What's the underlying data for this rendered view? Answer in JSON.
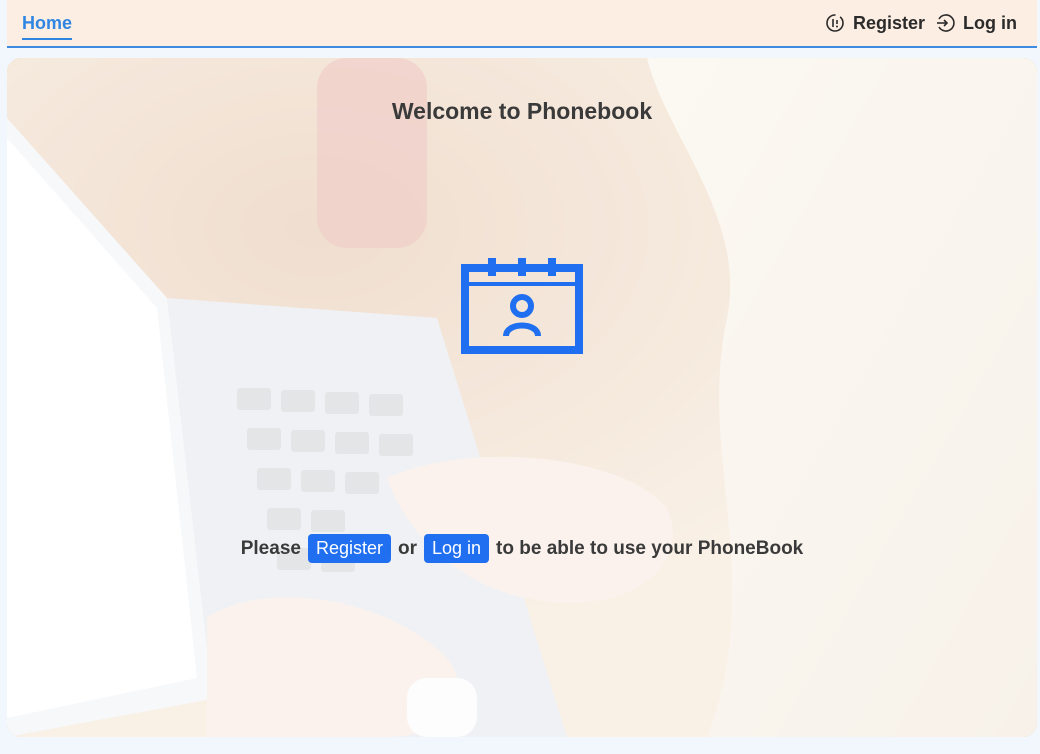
{
  "nav": {
    "home_label": "Home",
    "register_label": "Register",
    "register_icon": "register-icon",
    "login_label": "Log in",
    "login_icon": "login-icon",
    "active_color": "#2f86e2"
  },
  "hero": {
    "title": "Welcome to Phonebook",
    "icon": "contact-calendar-icon",
    "cta": {
      "prefix": "Please",
      "register_button": "Register",
      "connector": "or",
      "login_button": "Log in",
      "suffix": "to be able to use your PhoneBook"
    },
    "accent_color": "#1f6ff0"
  }
}
